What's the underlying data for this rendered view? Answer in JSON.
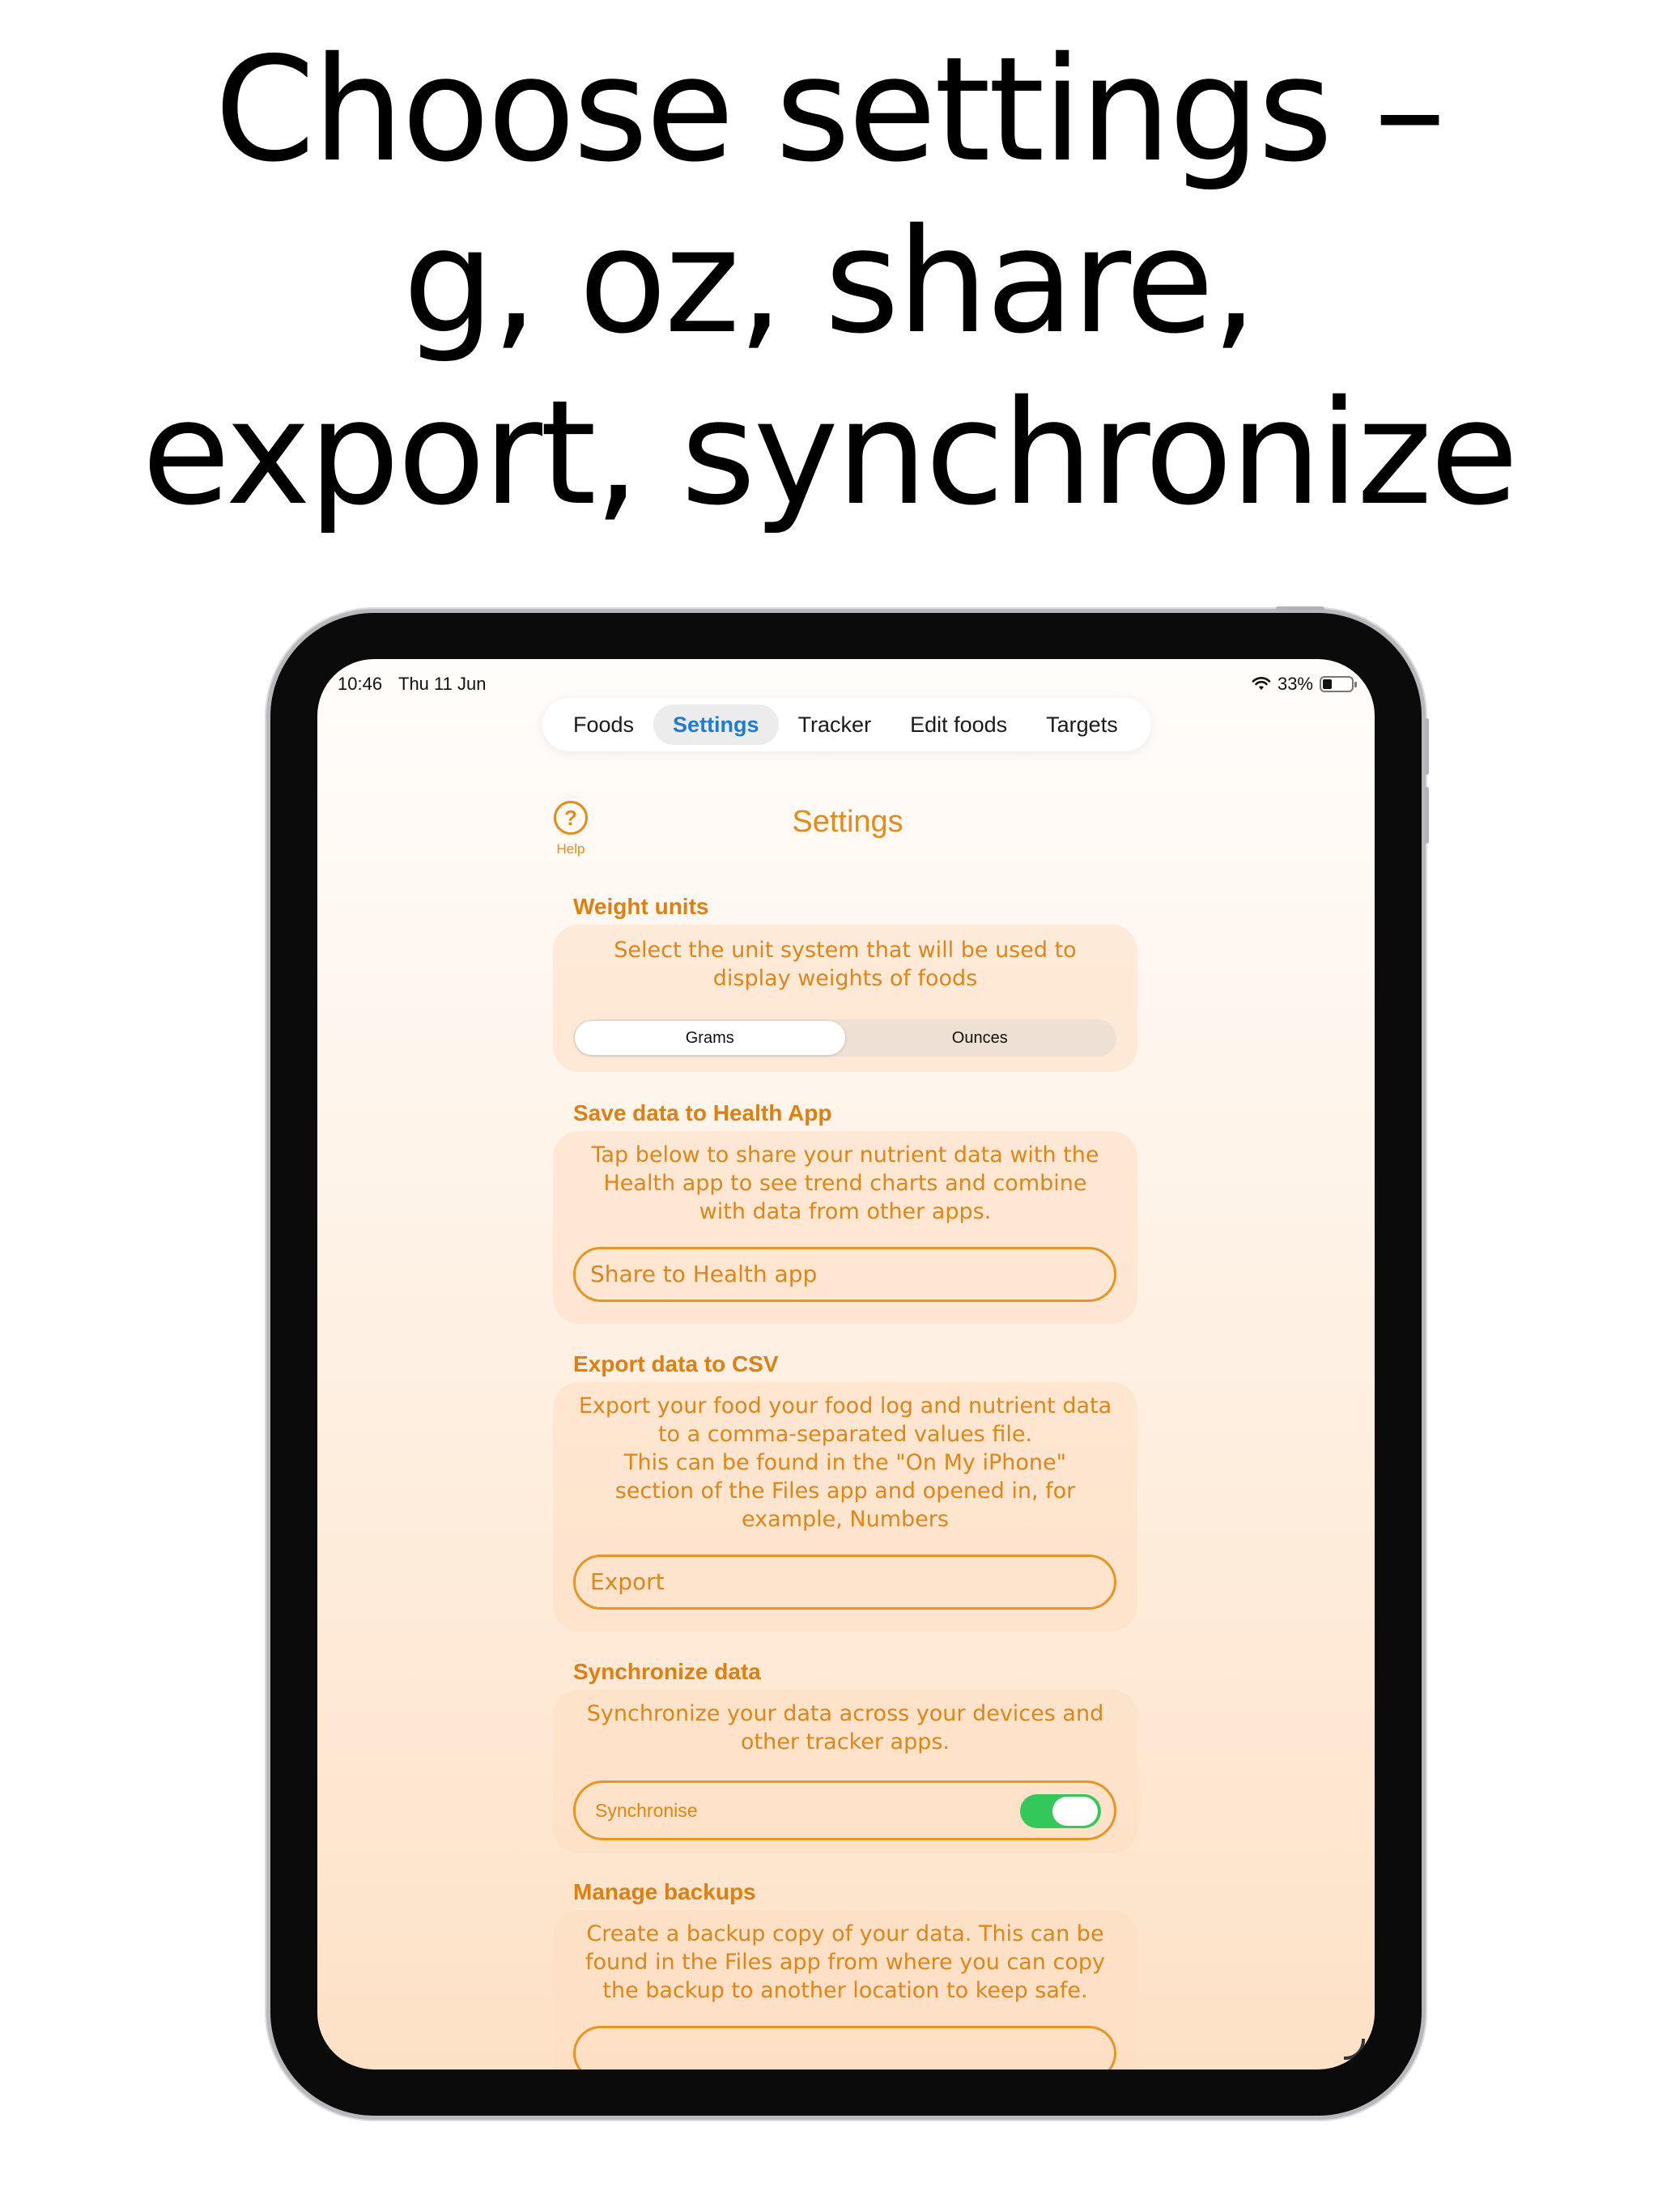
{
  "headline": {
    "line1": "Choose settings –",
    "line2": "g, oz, share,",
    "line3": "export, synchronize"
  },
  "status_bar": {
    "time": "10:46",
    "date": "Thu 11 Jun",
    "battery": "33%",
    "battery_level": 0.33,
    "wifi_icon": "wifi-icon"
  },
  "tabs": [
    {
      "label": "Foods",
      "active": false
    },
    {
      "label": "Settings",
      "active": true
    },
    {
      "label": "Tracker",
      "active": false
    },
    {
      "label": "Edit foods",
      "active": false
    },
    {
      "label": "Targets",
      "active": false
    }
  ],
  "help": {
    "symbol": "?",
    "label": "Help"
  },
  "page_title": "Settings",
  "weight_units": {
    "title": "Weight units",
    "text_line1": "Select the unit system that will be used to",
    "text_line2": "display weights of foods",
    "options": [
      "Grams",
      "Ounces"
    ],
    "selected": "Grams"
  },
  "health": {
    "title": "Save data to Health App",
    "text_line1": "Tap below to share your nutrient data with the",
    "text_line2": "Health app to see trend charts and combine",
    "text_line3": "with data from other apps.",
    "button": "Share to Health app"
  },
  "export": {
    "title": "Export data to CSV",
    "text_line1": "Export your food your food log and nutrient data",
    "text_line2": "to a comma-separated values file.",
    "text_line3": "This can be found in the \"On My iPhone\"",
    "text_line4": "section of the Files app and opened in, for",
    "text_line5": "example, Numbers",
    "button": "Export"
  },
  "sync": {
    "title": "Synchronize data",
    "text_line1": "Synchronize your data across your devices and",
    "text_line2": "other tracker apps.",
    "toggle_label": "Synchronise",
    "toggle_on": true
  },
  "backups": {
    "title": "Manage backups",
    "text_line1": "Create a backup copy of your data. This can be",
    "text_line2": "found in the Files app from where you can copy",
    "text_line3": "the backup to another location to keep safe."
  },
  "colors": {
    "accent": "#e88a14",
    "tab_active": "#1a7dd6",
    "toggle_on": "#34c759"
  }
}
